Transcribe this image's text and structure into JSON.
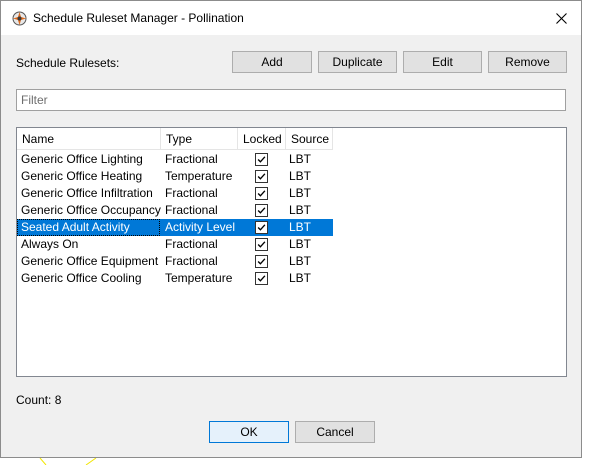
{
  "window": {
    "title": "Schedule Ruleset Manager - Pollination"
  },
  "toolbar": {
    "label": "Schedule Rulesets:",
    "add_label": "Add",
    "duplicate_label": "Duplicate",
    "edit_label": "Edit",
    "remove_label": "Remove"
  },
  "filter": {
    "placeholder": "Filter",
    "value": ""
  },
  "table": {
    "columns": [
      "Name",
      "Type",
      "Locked",
      "Source"
    ],
    "rows": [
      {
        "name": "Generic Office Lighting",
        "type": "Fractional",
        "locked": true,
        "source": "LBT"
      },
      {
        "name": "Generic Office Heating",
        "type": "Temperature",
        "locked": true,
        "source": "LBT"
      },
      {
        "name": "Generic Office Infiltration",
        "type": "Fractional",
        "locked": true,
        "source": "LBT"
      },
      {
        "name": "Generic Office Occupancy",
        "type": "Fractional",
        "locked": true,
        "source": "LBT"
      },
      {
        "name": "Seated Adult Activity",
        "type": "Activity Level",
        "locked": true,
        "source": "LBT",
        "selected": true
      },
      {
        "name": "Always On",
        "type": "Fractional",
        "locked": true,
        "source": "LBT"
      },
      {
        "name": "Generic Office Equipment",
        "type": "Fractional",
        "locked": true,
        "source": "LBT"
      },
      {
        "name": "Generic Office Cooling",
        "type": "Temperature",
        "locked": true,
        "source": "LBT"
      }
    ]
  },
  "footer": {
    "count_label": "Count: 8",
    "ok_label": "OK",
    "cancel_label": "Cancel"
  },
  "colors": {
    "selection": "#0078d7",
    "button_face": "#e1e1e1",
    "window_bg": "#f0f0f0",
    "deco_line": "#f2e600"
  },
  "icons": [
    "app-logo-icon",
    "close-icon",
    "checkbox-checked-icon"
  ]
}
